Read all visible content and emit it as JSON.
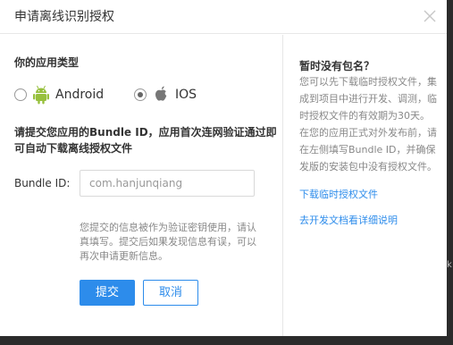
{
  "dialog": {
    "title": "申请离线识别授权"
  },
  "form": {
    "app_type_label": "你的应用类型",
    "os_options": [
      {
        "label": "Android",
        "selected": false,
        "icon": "android-icon"
      },
      {
        "label": "IOS",
        "selected": true,
        "icon": "apple-icon"
      }
    ],
    "notice": "请提交您应用的Bundle ID，应用首次连网验证通过即可自动下载离线授权文件",
    "bundle_id_label": "Bundle ID:",
    "bundle_id_value": "com.hanjunqiang",
    "hint": "您提交的信息被作为验证密钥使用，请认真填写。提交后如果发现信息有误，可以再次申请更新信息。",
    "submit_label": "提交",
    "cancel_label": "取消"
  },
  "sidebar": {
    "title": "暂时没有包名？",
    "body": "您可以先下载临时授权文件，集成到项目中进行开发、调测，临时授权文件的有效期为30天。在您的应用正式对外发布前，请在左侧填写Bundle ID，并确保发版的安装包中没有授权文件。",
    "download_link": "下载临时授权文件",
    "docs_link": "去开发文档看详细说明"
  },
  "backdrop": {
    "edge_glyph": "k"
  },
  "colors": {
    "accent": "#2d8ceb",
    "android_green": "#97c03d"
  }
}
